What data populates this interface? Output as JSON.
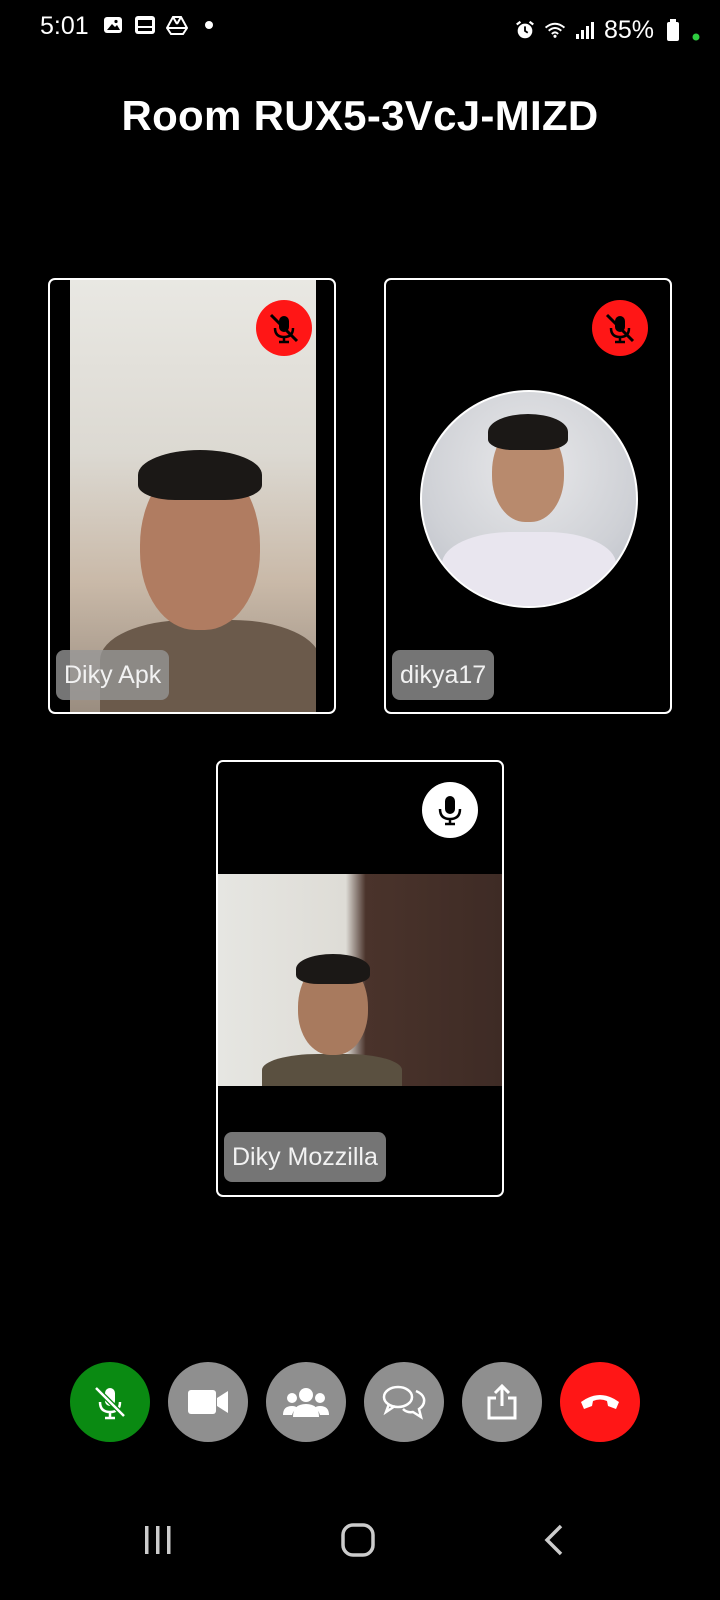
{
  "status_bar": {
    "time": "5:01",
    "battery": "85%",
    "icons": [
      "image-icon",
      "app-icon",
      "drive-icon",
      "dot-icon",
      "alarm-icon",
      "wifi-icon",
      "signal-icon",
      "battery-icon"
    ]
  },
  "room": {
    "title": "Room RUX5-3VcJ-MIZD"
  },
  "participants": [
    {
      "name": "Diky Apk",
      "mic": "muted",
      "media": "camera"
    },
    {
      "name": "dikya17",
      "mic": "muted",
      "media": "avatar"
    },
    {
      "name": "Diky Mozzilla",
      "mic": "on",
      "media": "camera"
    }
  ],
  "controls": [
    {
      "name": "mic-toggle",
      "icon": "mic-off-icon",
      "color": "#0a8a12"
    },
    {
      "name": "camera-toggle",
      "icon": "video-camera-icon",
      "color": "#8f8f8f"
    },
    {
      "name": "participants",
      "icon": "people-icon",
      "color": "#8f8f8f"
    },
    {
      "name": "chat",
      "icon": "chat-icon",
      "color": "#8f8f8f"
    },
    {
      "name": "share",
      "icon": "share-icon",
      "color": "#8f8f8f"
    },
    {
      "name": "end-call",
      "icon": "hang-up-icon",
      "color": "#ff1616"
    }
  ],
  "nav": [
    "recent-apps-icon",
    "home-icon",
    "back-icon"
  ]
}
